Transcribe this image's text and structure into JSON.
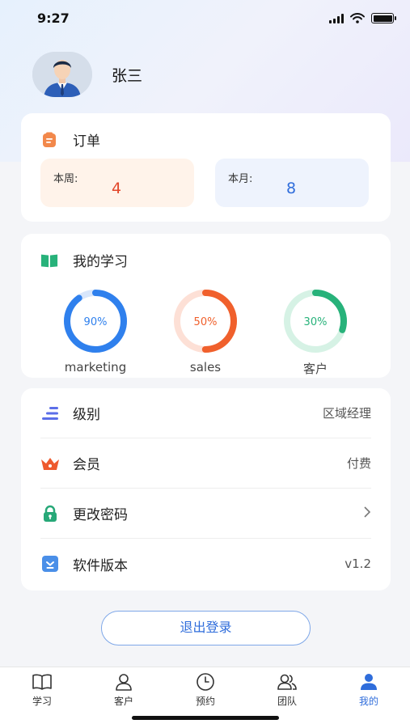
{
  "status_bar": {
    "time": "9:27"
  },
  "profile": {
    "name": "张三"
  },
  "orders": {
    "title": "订单",
    "week_label": "本周:",
    "week_value": "4",
    "month_label": "本月:",
    "month_value": "8"
  },
  "study": {
    "title": "我的学习",
    "rings": [
      {
        "label": "marketing",
        "percent_text": "90%",
        "percent": 90,
        "color": "#2f80ed",
        "track": "#d8e6fb"
      },
      {
        "label": "sales",
        "percent_text": "50%",
        "percent": 50,
        "color": "#f0602c",
        "track": "#fde0d6"
      },
      {
        "label": "客户",
        "percent_text": "30%",
        "percent": 30,
        "color": "#27b27a",
        "track": "#d6f2e5"
      }
    ]
  },
  "menu": {
    "level_label": "级别",
    "level_value": "区域经理",
    "member_label": "会员",
    "member_value": "付费",
    "password_label": "更改密码",
    "version_label": "软件版本",
    "version_value": "v1.2"
  },
  "logout_label": "退出登录",
  "tabs": [
    {
      "label": "学习",
      "icon": "book-icon"
    },
    {
      "label": "客户",
      "icon": "person-icon"
    },
    {
      "label": "预约",
      "icon": "clock-icon"
    },
    {
      "label": "团队",
      "icon": "team-icon"
    },
    {
      "label": "我的",
      "icon": "profile-icon",
      "active": true
    }
  ],
  "colors": {
    "accent": "#2f6ddb",
    "orange": "#f0602c",
    "green": "#27b27a"
  }
}
